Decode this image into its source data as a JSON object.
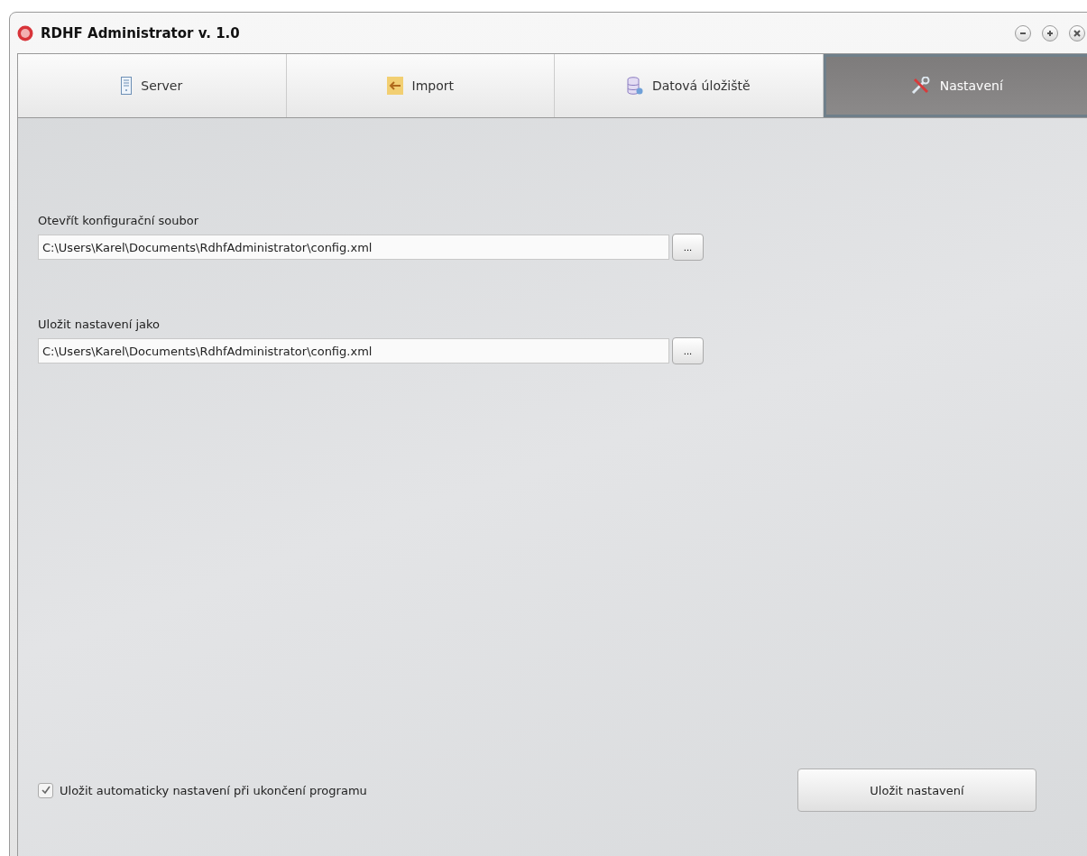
{
  "window": {
    "title": "RDHF Administrator v. 1.0"
  },
  "tabs": [
    {
      "label": "Server",
      "selected": false
    },
    {
      "label": "Import",
      "selected": false
    },
    {
      "label": "Datová úložiště",
      "selected": false
    },
    {
      "label": "Nastavení",
      "selected": true
    }
  ],
  "fields": [
    {
      "label": "Otevřít konfigurační soubor",
      "value": "C:\\Users\\Karel\\Documents\\RdhfAdministrator\\config.xml",
      "button": "..."
    },
    {
      "label": "Uložit nastavení jako",
      "value": "C:\\Users\\Karel\\Documents\\RdhfAdministrator\\config.xml",
      "button": "..."
    }
  ],
  "autosave": {
    "label": "Uložit automaticky nastavení při ukončení programu",
    "checked": true
  },
  "save_button": "Uložit nastavení"
}
